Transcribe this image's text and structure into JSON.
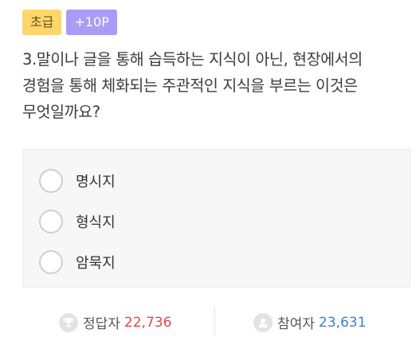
{
  "quiz": {
    "level_badge": "초급",
    "points_badge": "+10P",
    "question": "3.말이나 글을 통해 습득하는 지식이 아닌, 현장에서의 경험을 통해 체화되는 주관적인 지식을 부르는 이것은 무엇일까요?",
    "options": [
      {
        "label": "명시지"
      },
      {
        "label": "형식지"
      },
      {
        "label": "암묵지"
      }
    ]
  },
  "stats": {
    "correct_label": "정답자",
    "correct_count": "22,736",
    "participants_label": "참여자",
    "participants_count": "23,631"
  },
  "colors": {
    "level_badge_bg": "#ffd66b",
    "points_badge_bg": "#a99cf7",
    "correct_count": "#e04848",
    "participants_count": "#3c7fd9"
  },
  "icons": {
    "correct": "trophy-icon",
    "participants": "person-icon"
  }
}
